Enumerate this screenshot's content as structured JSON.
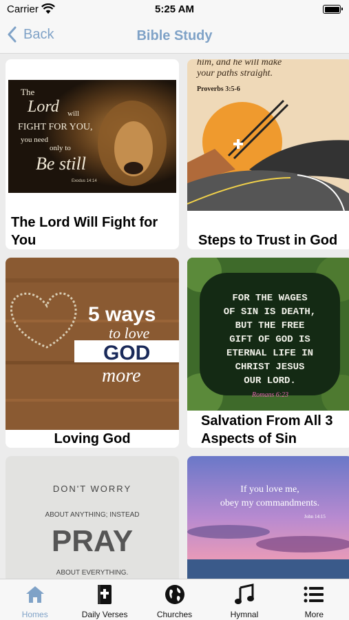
{
  "status_bar": {
    "carrier": "Carrier",
    "time": "5:25 AM"
  },
  "nav": {
    "back_label": "Back",
    "title": "Bible Study"
  },
  "cards": [
    {
      "label": "The Lord Will Fight for You",
      "image_text": {
        "l1": "The",
        "l2": "Lord",
        "l3": "will",
        "l4": "FIGHT FOR YOU,",
        "l5": "you need",
        "l6": "only to",
        "l7": "Be still",
        "ref": "Exodus 14:14"
      }
    },
    {
      "label": "Steps to Trust in God",
      "image_text": {
        "top": "him, and he will make",
        "top2": "your paths straight.",
        "ref": "Proverbs 3:5-6"
      }
    },
    {
      "label": "Loving God",
      "image_text": {
        "l1": "5 ways",
        "l2": "to love",
        "l3": "GOD",
        "l4": "more"
      }
    },
    {
      "label": "Salvation From All 3 Aspects of Sin",
      "image_text": {
        "lines": [
          "FOR THE WAGES",
          "OF SIN IS DEATH,",
          "BUT THE FREE",
          "GIFT OF GOD IS",
          "ETERNAL LIFE IN",
          "CHRIST JESUS",
          "OUR LORD."
        ],
        "ref": "Romans 6:23"
      }
    },
    {
      "label": "",
      "image_text": {
        "l1": "DON'T WORRY",
        "l2": "ABOUT ANYTHING; INSTEAD",
        "l3": "PRAY",
        "l4": "ABOUT EVERYTHING."
      }
    },
    {
      "label": "",
      "image_text": {
        "l1": "If you love me,",
        "l2": "obey my commandments.",
        "ref": "John 14:15"
      }
    }
  ],
  "tabs": [
    {
      "label": "Homes",
      "icon": "home-icon",
      "active": true
    },
    {
      "label": "Daily Verses",
      "icon": "bible-icon",
      "active": false
    },
    {
      "label": "Churches",
      "icon": "globe-icon",
      "active": false
    },
    {
      "label": "Hymnal",
      "icon": "music-note-icon",
      "active": false
    },
    {
      "label": "More",
      "icon": "list-icon",
      "active": false
    }
  ],
  "colors": {
    "accent": "#7fa2c7",
    "inactive_icon": "#111111",
    "background": "#ececec"
  }
}
